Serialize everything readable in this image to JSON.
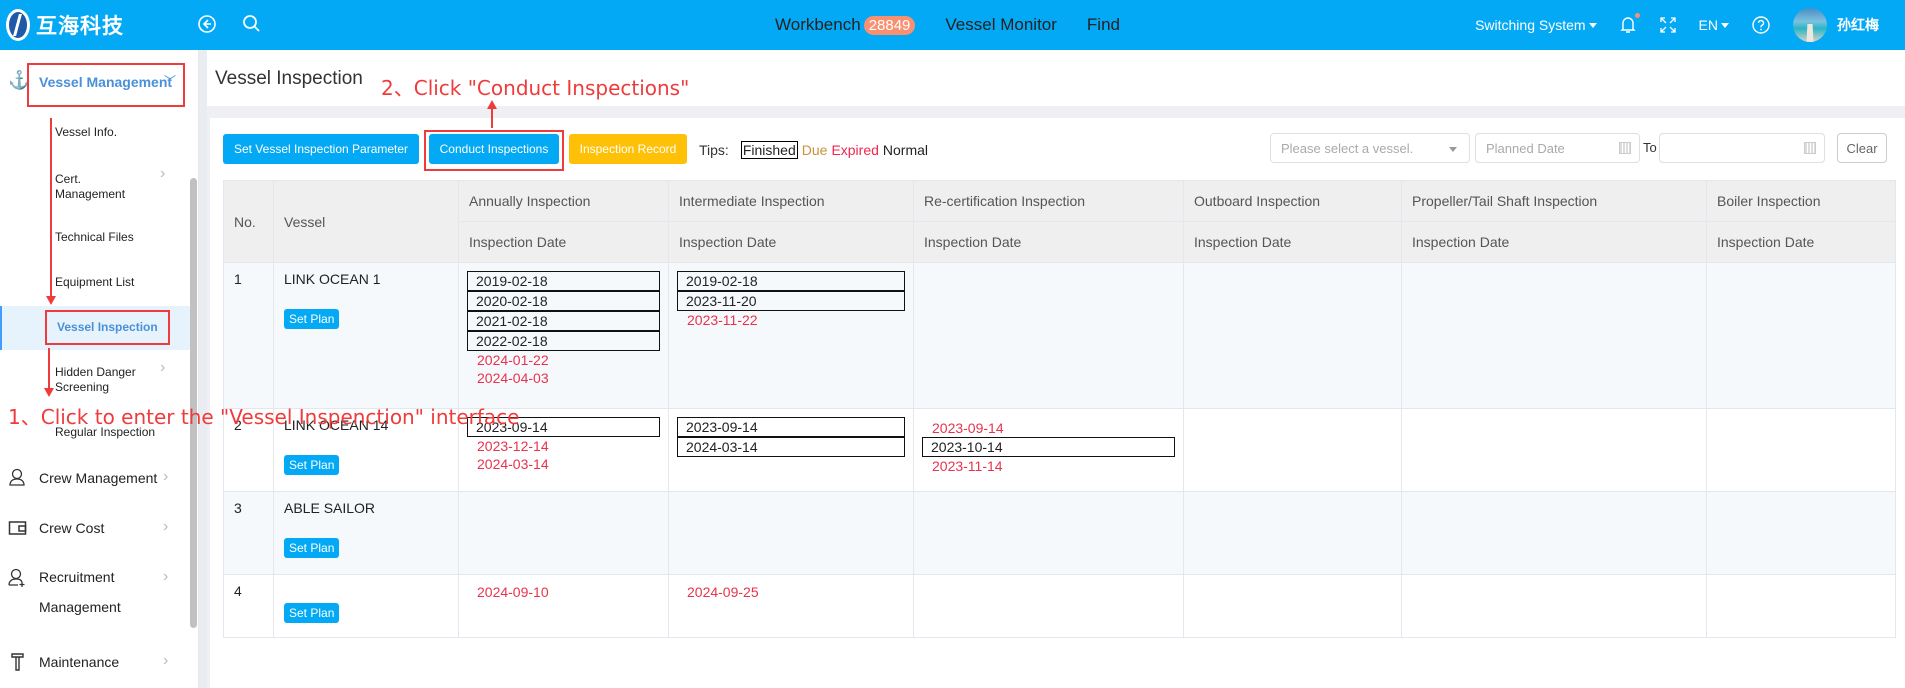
{
  "header": {
    "brand": "互海科技",
    "nav": [
      {
        "label": "Workbench",
        "badge": "28849"
      },
      {
        "label": "Vessel Monitor"
      },
      {
        "label": "Find"
      }
    ],
    "switching_system": "Switching System",
    "language": "EN",
    "username": "孙红梅",
    "colors": {
      "bar": "#03a9f4",
      "badge": "#f99070"
    }
  },
  "sidebar": {
    "parent": {
      "label": "Vessel Management",
      "icon": "anchor-icon"
    },
    "sub_items": [
      {
        "label": "Vessel Info."
      },
      {
        "label": "Cert. Management",
        "has_children": true
      },
      {
        "label": "Technical Files"
      },
      {
        "label": "Equipment List"
      },
      {
        "label": "Vessel Inspection",
        "active": true
      },
      {
        "label": "Hidden Danger Screening",
        "has_children": true
      },
      {
        "label": "Regular Inspection"
      }
    ],
    "main_items": [
      {
        "label": "Crew Management",
        "icon": "user-icon"
      },
      {
        "label": "Crew Cost",
        "icon": "wallet-icon"
      },
      {
        "label": "Recruitment Management",
        "icon": "user-add-icon"
      },
      {
        "label": "Maintenance",
        "icon": "hammer-icon"
      }
    ]
  },
  "page": {
    "title": "Vessel Inspection",
    "toolbar": {
      "set_param": "Set Vessel Inspection Parameter",
      "conduct": "Conduct Inspections",
      "record": "Inspection Record",
      "tips_label": "Tips:",
      "legend": {
        "finished": "Finished",
        "due": "Due",
        "expired": "Expired",
        "normal": "Normal"
      },
      "legend_colors": {
        "due": "#c9923a",
        "expired": "#f0274e"
      }
    },
    "filters": {
      "vessel_placeholder": "Please select a vessel.",
      "planned_date_placeholder": "Planned Date",
      "to_label": "To",
      "clear": "Clear"
    }
  },
  "table": {
    "columns": {
      "no": "No.",
      "vessel": "Vessel",
      "groups": [
        "Annually Inspection",
        "Intermediate Inspection",
        "Re-certification Inspection",
        "Outboard Inspection",
        "Propeller/Tail Shaft Inspection",
        "Boiler Inspection"
      ],
      "sub": "Inspection Date"
    },
    "set_plan_label": "Set Plan",
    "rows": [
      {
        "no": "1",
        "vessel": "LINK OCEAN 1",
        "cells": [
          [
            {
              "d": "2019-02-18",
              "s": "finished"
            },
            {
              "d": "2020-02-18",
              "s": "finished"
            },
            {
              "d": "2021-02-18",
              "s": "finished"
            },
            {
              "d": "2022-02-18",
              "s": "finished"
            },
            {
              "d": "2024-01-22",
              "s": "expired"
            },
            {
              "d": "2024-04-03",
              "s": "expired"
            }
          ],
          [
            {
              "d": "2019-02-18",
              "s": "finished"
            },
            {
              "d": "2023-11-20",
              "s": "finished"
            },
            {
              "d": "2023-11-22",
              "s": "expired"
            }
          ],
          [],
          [],
          [],
          []
        ]
      },
      {
        "no": "2",
        "vessel": "LINK OCEAN 14",
        "cells": [
          [
            {
              "d": "2023-09-14",
              "s": "finished"
            },
            {
              "d": "2023-12-14",
              "s": "expired"
            },
            {
              "d": "2024-03-14",
              "s": "expired"
            }
          ],
          [
            {
              "d": "2023-09-14",
              "s": "finished"
            },
            {
              "d": "2024-03-14",
              "s": "finished"
            }
          ],
          [
            {
              "d": "2023-09-14",
              "s": "expired"
            },
            {
              "d": "2023-10-14",
              "s": "finished"
            },
            {
              "d": "2023-11-14",
              "s": "expired"
            }
          ],
          [],
          [],
          []
        ]
      },
      {
        "no": "3",
        "vessel": "ABLE SAILOR",
        "cells": [
          [],
          [],
          [],
          [],
          [],
          []
        ]
      },
      {
        "no": "4",
        "vessel": "",
        "cells": [
          [
            {
              "d": "2024-09-10",
              "s": "expired"
            }
          ],
          [
            {
              "d": "2024-09-25",
              "s": "expired"
            }
          ],
          [],
          [],
          [],
          []
        ]
      }
    ]
  },
  "annotations": {
    "step1": "1、Click to enter the \"Vessel Inspenction\" interface",
    "step2": "2、Click \"Conduct Inspections\""
  }
}
